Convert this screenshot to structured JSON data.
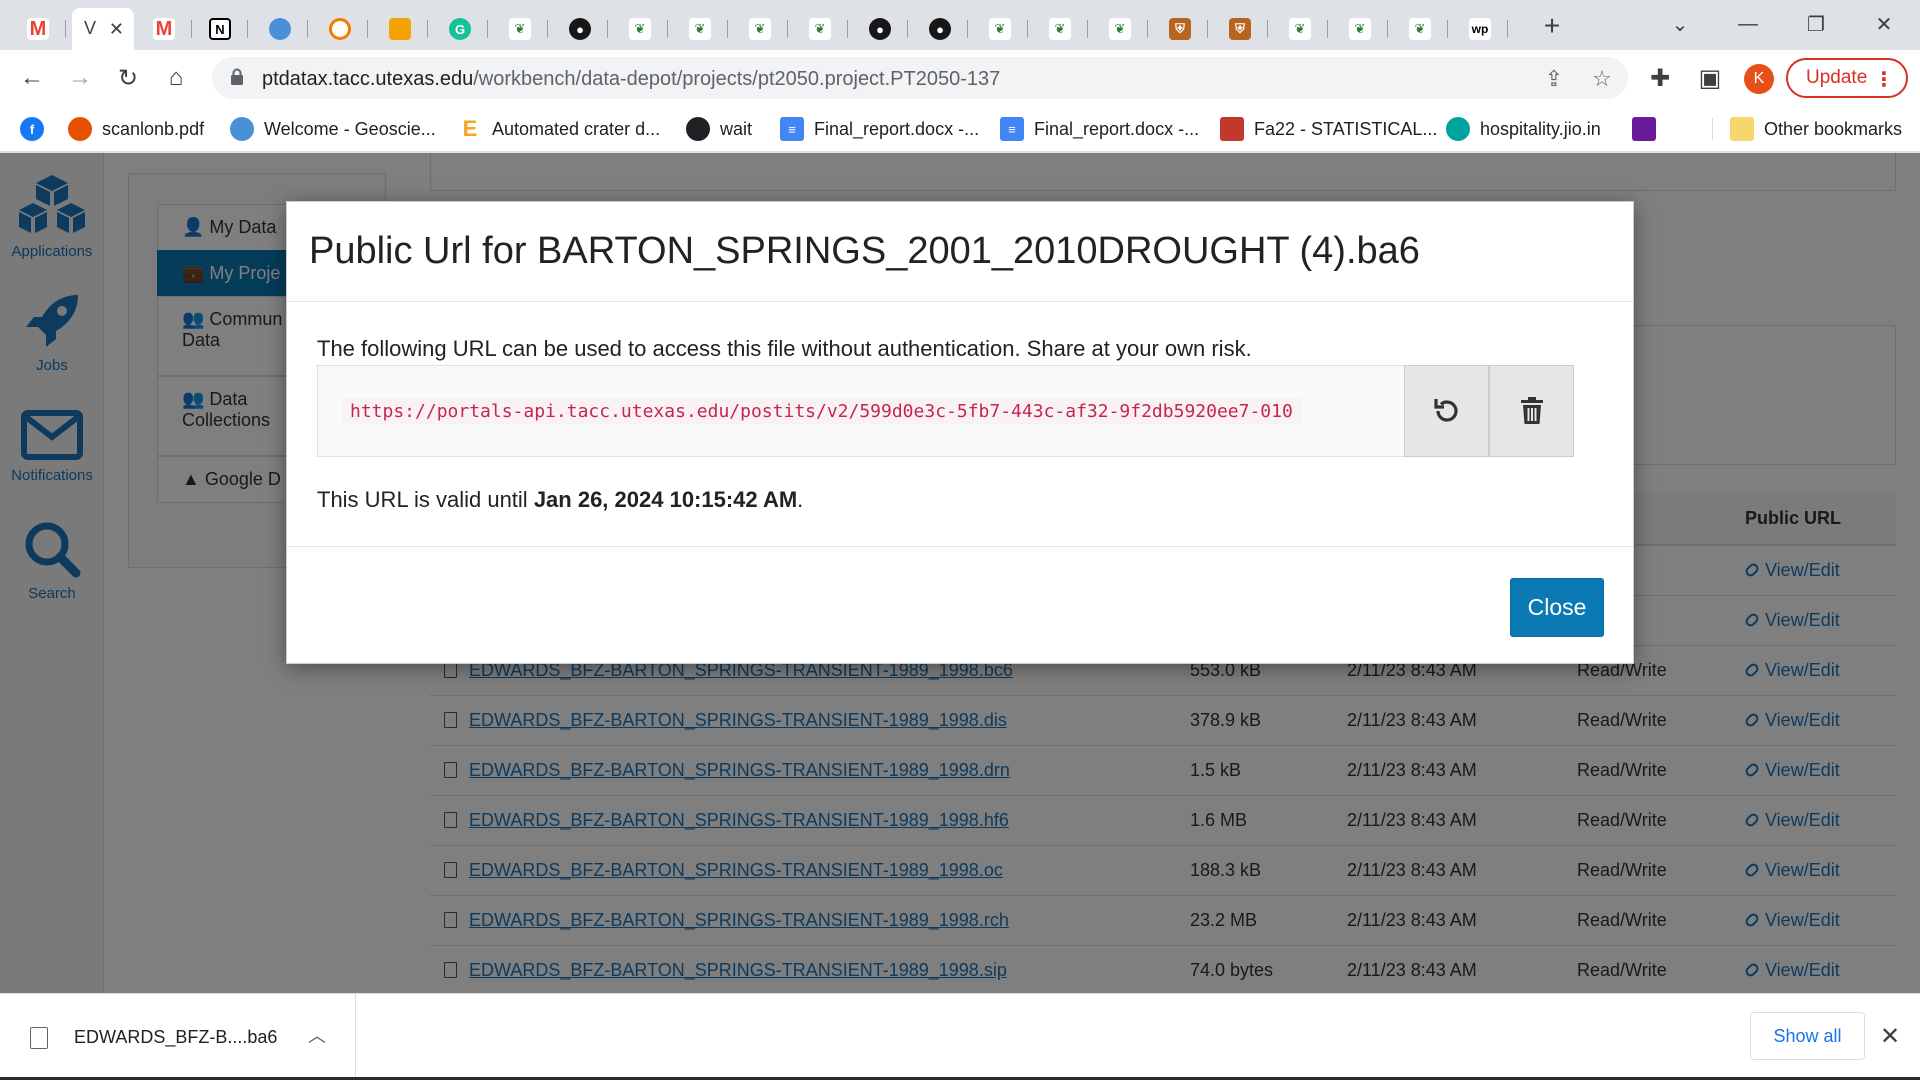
{
  "browser": {
    "active_tab_letter": "V",
    "url_host": "ptdatax.tacc.utexas.edu",
    "url_path": "/workbench/data-depot/projects/pt2050.project.PT2050-137",
    "profile_initial": "K",
    "update_label": "Update"
  },
  "bookmarks": [
    {
      "label": "",
      "icon": "facebook-icon",
      "color": "#1877f2"
    },
    {
      "label": "scanlonb.pdf",
      "icon": "pdf-icon",
      "color": "#e65100"
    },
    {
      "label": "Welcome - Geoscie...",
      "icon": "cloud-icon",
      "color": "#4a90d9"
    },
    {
      "label": "Automated crater d...",
      "icon": "e-icon",
      "color": "#f5a623"
    },
    {
      "label": "wait",
      "icon": "wait-icon",
      "color": "#202124"
    },
    {
      "label": "Final_report.docx -...",
      "icon": "docs-icon",
      "color": "#4285f4"
    },
    {
      "label": "Final_report.docx -...",
      "icon": "docs-icon",
      "color": "#4285f4"
    },
    {
      "label": "Fa22 - STATISTICAL...",
      "icon": "course-icon",
      "color": "#c0392b"
    },
    {
      "label": "hospitality.jio.in",
      "icon": "globe-icon",
      "color": "#00a39b"
    },
    {
      "label": "",
      "icon": "chart-icon",
      "color": "#6a1b9a"
    },
    {
      "label": "Other bookmarks",
      "icon": "folder-icon",
      "color": "#f9d56e"
    }
  ],
  "leftnav": [
    {
      "label": "Applications",
      "icon": "applications-icon"
    },
    {
      "label": "Jobs",
      "icon": "rocket-icon"
    },
    {
      "label": "Notifications",
      "icon": "envelope-icon"
    },
    {
      "label": "Search",
      "icon": "search-icon"
    }
  ],
  "sidepanel": [
    {
      "label": "My Data",
      "icon": "user-icon"
    },
    {
      "label": "My Proje",
      "icon": "briefcase-icon"
    },
    {
      "label": "Commun\nData",
      "icon": "users-icon"
    },
    {
      "label": "Data\nCollections",
      "icon": "users-icon"
    },
    {
      "label": "Google D",
      "icon": "google-drive-icon"
    }
  ],
  "table": {
    "headers": [
      "",
      "",
      "",
      "sions",
      "Public URL"
    ],
    "rows": [
      {
        "name": "",
        "size": "",
        "date": "",
        "perm": "Write",
        "url": "View/Edit"
      },
      {
        "name": "",
        "size": "",
        "date": "",
        "perm": "Write",
        "url": "View/Edit"
      },
      {
        "name": "EDWARDS_BFZ-BARTON_SPRINGS-TRANSIENT-1989_1998.bc6",
        "size": "553.0 kB",
        "date": "2/11/23 8:43 AM",
        "perm": "Read/Write",
        "url": "View/Edit"
      },
      {
        "name": "EDWARDS_BFZ-BARTON_SPRINGS-TRANSIENT-1989_1998.dis",
        "size": "378.9 kB",
        "date": "2/11/23 8:43 AM",
        "perm": "Read/Write",
        "url": "View/Edit"
      },
      {
        "name": "EDWARDS_BFZ-BARTON_SPRINGS-TRANSIENT-1989_1998.drn",
        "size": "1.5 kB",
        "date": "2/11/23 8:43 AM",
        "perm": "Read/Write",
        "url": "View/Edit"
      },
      {
        "name": "EDWARDS_BFZ-BARTON_SPRINGS-TRANSIENT-1989_1998.hf6",
        "size": "1.6 MB",
        "date": "2/11/23 8:43 AM",
        "perm": "Read/Write",
        "url": "View/Edit"
      },
      {
        "name": "EDWARDS_BFZ-BARTON_SPRINGS-TRANSIENT-1989_1998.oc",
        "size": "188.3 kB",
        "date": "2/11/23 8:43 AM",
        "perm": "Read/Write",
        "url": "View/Edit"
      },
      {
        "name": "EDWARDS_BFZ-BARTON_SPRINGS-TRANSIENT-1989_1998.rch",
        "size": "23.2 MB",
        "date": "2/11/23 8:43 AM",
        "perm": "Read/Write",
        "url": "View/Edit"
      },
      {
        "name": "EDWARDS_BFZ-BARTON_SPRINGS-TRANSIENT-1989_1998.sip",
        "size": "74.0 bytes",
        "date": "2/11/23 8:43 AM",
        "perm": "Read/Write",
        "url": "View/Edit"
      }
    ]
  },
  "modal": {
    "title": "Public Url for BARTON_SPRINGS_2001_2010DROUGHT (4).ba6",
    "description": "The following URL can be used to access this file without authentication. Share at your own risk.",
    "public_url": "https://portals-api.tacc.utexas.edu/postits/v2/599d0e3c-5fb7-443c-af32-9f2db5920ee7-010",
    "valid_prefix": "This URL is valid until ",
    "valid_until": "Jan 26, 2024 10:15:42 AM",
    "valid_suffix": ".",
    "close_label": "Close",
    "refresh_icon": "refresh-icon",
    "delete_icon": "trash-icon"
  },
  "downloads": {
    "filename": "EDWARDS_BFZ-B....ba6",
    "show_all": "Show all"
  },
  "colors": {
    "accent": "#0b79b3",
    "link": "#1b75bb",
    "code": "#c7254e",
    "update": "#d93025"
  }
}
